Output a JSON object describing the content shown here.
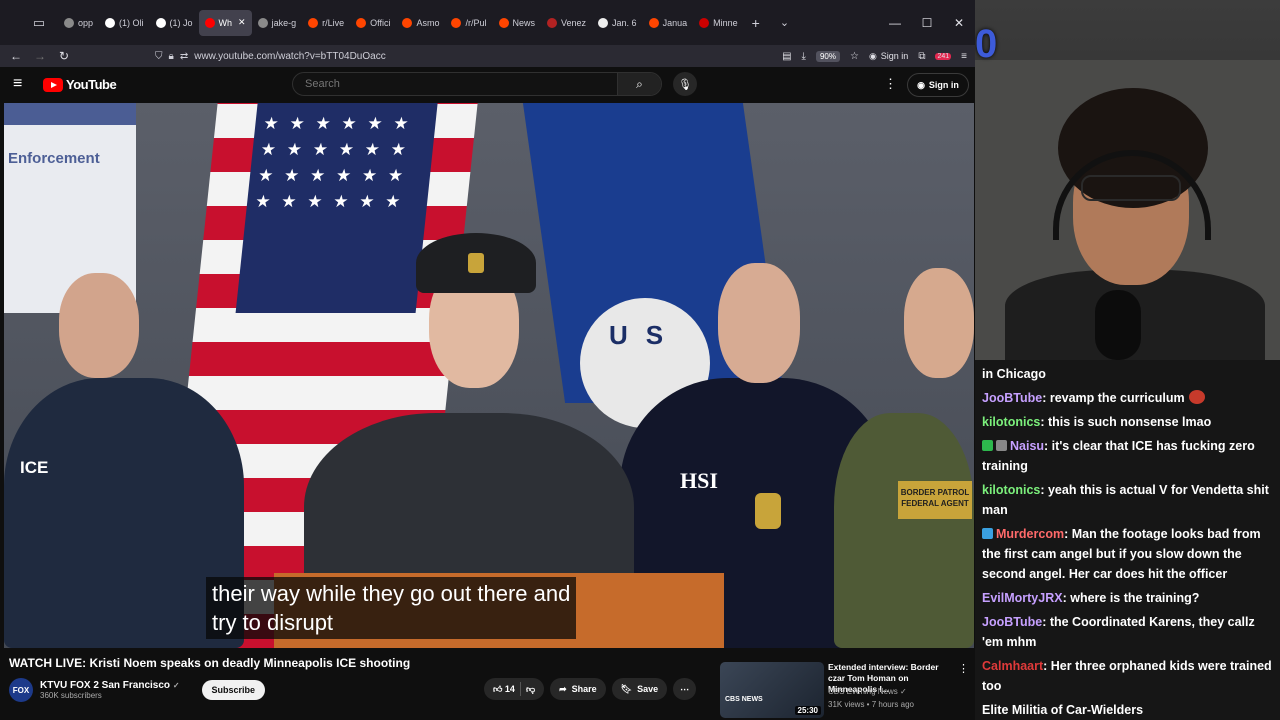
{
  "browser": {
    "tabs": [
      {
        "label": "opp",
        "fav": "#8a8a8a"
      },
      {
        "label": "(1) Oli",
        "fav": "#ffffff"
      },
      {
        "label": "(1) Jo",
        "fav": "#ffffff"
      },
      {
        "label": "Wh",
        "fav": "#ff0000",
        "active": true
      },
      {
        "label": "jake-g",
        "fav": "#8a8a8a"
      },
      {
        "label": "r/Live",
        "fav": "#ff4500"
      },
      {
        "label": "Offici",
        "fav": "#ff4500"
      },
      {
        "label": "Asmo",
        "fav": "#ff4500"
      },
      {
        "label": "/r/Pul",
        "fav": "#ff4500"
      },
      {
        "label": "News",
        "fav": "#ff4500"
      },
      {
        "label": "Venez",
        "fav": "#b22222"
      },
      {
        "label": "Jan. 6",
        "fav": "#eeeeee"
      },
      {
        "label": "Janua",
        "fav": "#ff4500"
      },
      {
        "label": "Minne",
        "fav": "#cc0000"
      }
    ],
    "url": "www.youtube.com/watch?v=bTT04DuOacc",
    "zoom": "90%",
    "signin": "Sign in",
    "ext_badge": "241"
  },
  "youtube": {
    "logo_text": "YouTube",
    "search_placeholder": "Search",
    "signin": "Sign in",
    "caption_line1": "their way while they go out there and",
    "caption_line2": "try to disrupt",
    "banner_text": "Enforcement",
    "vest_ice": "ICE",
    "vest_hsi": "HSI",
    "vest_patch": "BORDER PATROL FEDERAL AGENT",
    "seal_text": "US",
    "title": "WATCH LIVE: Kristi Noem speaks on deadly Minneapolis ICE shooting",
    "channel": {
      "name": "KTVU FOX 2 San Francisco",
      "subs": "360K subscribers",
      "avatar": "FOX"
    },
    "subscribe": "Subscribe",
    "likes": "14",
    "share": "Share",
    "save": "Save",
    "rec": {
      "title": "Extended interview: Border czar Tom Homan on Minneapolis I...",
      "channel": "CBS Evening News",
      "meta": "31K views • 7 hours ago",
      "duration": "25:30",
      "logo": "CBS NEWS"
    }
  },
  "webcam": {
    "overlay": "0"
  },
  "chat": {
    "messages": [
      {
        "user": "",
        "color": "#ffffff",
        "text": "in Chicago"
      },
      {
        "user": "JooBTube",
        "color": "#c6a0ff",
        "text": ": revamp the curriculum",
        "emote": true
      },
      {
        "user": "kilotonics",
        "color": "#7cf07c",
        "text": ": this is such nonsense lmao"
      },
      {
        "user": "Naisu",
        "color": "#c6a0ff",
        "text": ": it's clear that ICE has fucking zero training",
        "badges": [
          "#2db84d",
          "#888888"
        ]
      },
      {
        "user": "kilotonics",
        "color": "#7cf07c",
        "text": ": yeah this is actual V for Vendetta shit man"
      },
      {
        "user": "Murdercom",
        "color": "#ff6a6a",
        "text": ": Man the footage looks bad from the first cam angel but if you slow down the second angel. Her car does hit the officer",
        "badges": [
          "#3aa0e0"
        ]
      },
      {
        "user": "EvilMortyJRX",
        "color": "#c6a0ff",
        "text": ": where is the training?"
      },
      {
        "user": "JooBTube",
        "color": "#c6a0ff",
        "text": ": the Coordinated Karens, they callz 'em mhm"
      },
      {
        "user": "Calmhaart",
        "color": "#e03a3a",
        "text": ": Her three orphaned kids were trained too"
      },
      {
        "user": "",
        "color": "#ffffff",
        "text": "Elite Militia of Car-Wielders"
      }
    ]
  }
}
